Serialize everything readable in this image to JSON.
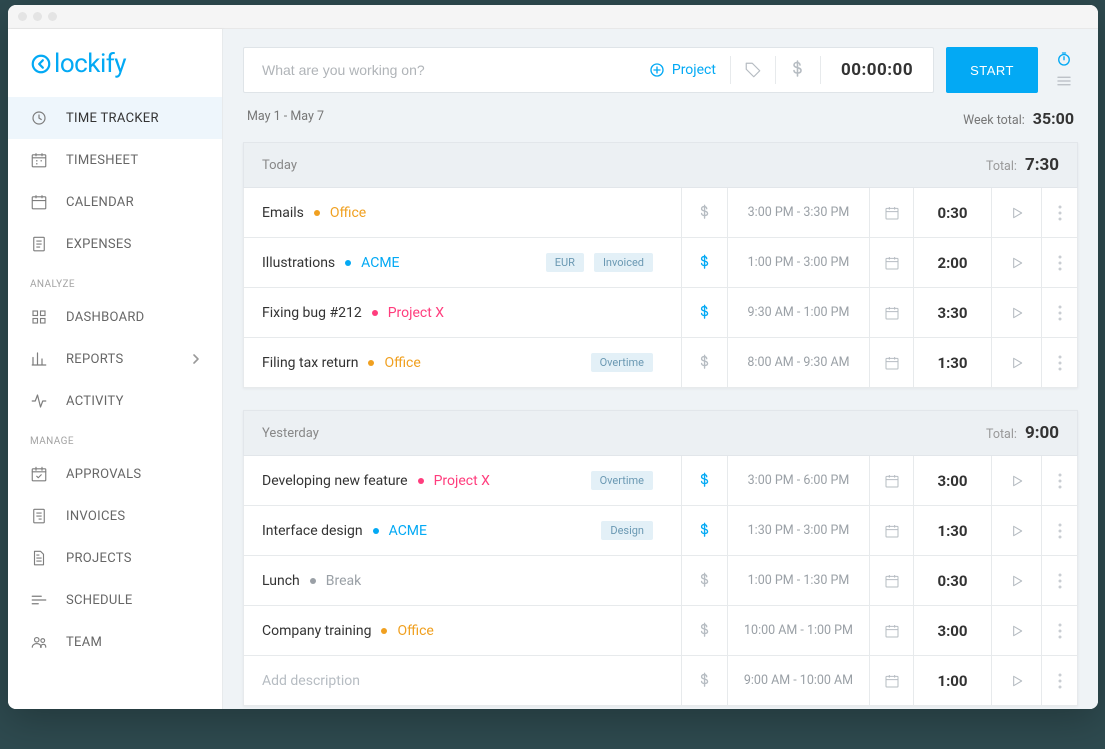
{
  "brand": "lockify",
  "sidebar": {
    "sections": [
      {
        "label": "",
        "items": [
          {
            "id": "time-tracker",
            "label": "TIME TRACKER",
            "icon": "clock",
            "active": true
          },
          {
            "id": "timesheet",
            "label": "TIMESHEET",
            "icon": "calendar-grid"
          },
          {
            "id": "calendar",
            "label": "CALENDAR",
            "icon": "calendar"
          },
          {
            "id": "expenses",
            "label": "EXPENSES",
            "icon": "receipt"
          }
        ]
      },
      {
        "label": "ANALYZE",
        "items": [
          {
            "id": "dashboard",
            "label": "DASHBOARD",
            "icon": "grid"
          },
          {
            "id": "reports",
            "label": "REPORTS",
            "icon": "bar-chart",
            "chevron": true
          },
          {
            "id": "activity",
            "label": "ACTIVITY",
            "icon": "activity"
          }
        ]
      },
      {
        "label": "MANAGE",
        "items": [
          {
            "id": "approvals",
            "label": "APPROVALS",
            "icon": "calendar-check"
          },
          {
            "id": "invoices",
            "label": "INVOICES",
            "icon": "invoice"
          },
          {
            "id": "projects",
            "label": "PROJECTS",
            "icon": "file"
          },
          {
            "id": "schedule",
            "label": "SCHEDULE",
            "icon": "schedule"
          },
          {
            "id": "team",
            "label": "TEAM",
            "icon": "team"
          }
        ]
      }
    ]
  },
  "tracker": {
    "placeholder": "What are you working on?",
    "project_btn": "Project",
    "timer": "00:00:00",
    "start": "START"
  },
  "summary": {
    "range": "May 1 - May 7",
    "label": "Week total:",
    "value": "35:00"
  },
  "groups": [
    {
      "title": "Today",
      "total": "7:30",
      "entries": [
        {
          "desc": "Emails",
          "project": "Office",
          "color": "#f0a020",
          "tags": [],
          "billable": false,
          "time": "3:00 PM - 3:30 PM",
          "dur": "0:30"
        },
        {
          "desc": "Illustrations",
          "project": "ACME",
          "color": "#03a9f4",
          "tags": [
            "EUR",
            "Invoiced"
          ],
          "billable": true,
          "time": "1:00 PM - 3:00 PM",
          "dur": "2:00"
        },
        {
          "desc": "Fixing bug #212",
          "project": "Project X",
          "color": "#ff3d7d",
          "tags": [],
          "billable": true,
          "time": "9:30 AM - 1:00 PM",
          "dur": "3:30"
        },
        {
          "desc": "Filing tax return",
          "project": "Office",
          "color": "#f0a020",
          "tags": [
            "Overtime"
          ],
          "billable": false,
          "time": "8:00 AM - 9:30 AM",
          "dur": "1:30"
        }
      ]
    },
    {
      "title": "Yesterday",
      "total": "9:00",
      "entries": [
        {
          "desc": "Developing new feature",
          "project": "Project X",
          "color": "#ff3d7d",
          "tags": [
            "Overtime"
          ],
          "billable": true,
          "time": "3:00 PM - 6:00 PM",
          "dur": "3:00"
        },
        {
          "desc": "Interface design",
          "project": "ACME",
          "color": "#03a9f4",
          "tags": [
            "Design"
          ],
          "billable": true,
          "time": "1:30 PM - 3:00 PM",
          "dur": "1:30"
        },
        {
          "desc": "Lunch",
          "project": "Break",
          "color": "#9aa0a6",
          "tags": [],
          "billable": false,
          "time": "1:00 PM - 1:30 PM",
          "dur": "0:30"
        },
        {
          "desc": "Company training",
          "project": "Office",
          "color": "#f0a020",
          "tags": [],
          "billable": false,
          "time": "10:00 AM - 1:00 PM",
          "dur": "3:00"
        },
        {
          "desc": "",
          "placeholder": "Add description",
          "project": "",
          "color": "",
          "tags": [],
          "billable": false,
          "time": "9:00 AM - 10:00 AM",
          "dur": "1:00"
        }
      ]
    }
  ],
  "labels": {
    "total": "Total:"
  }
}
